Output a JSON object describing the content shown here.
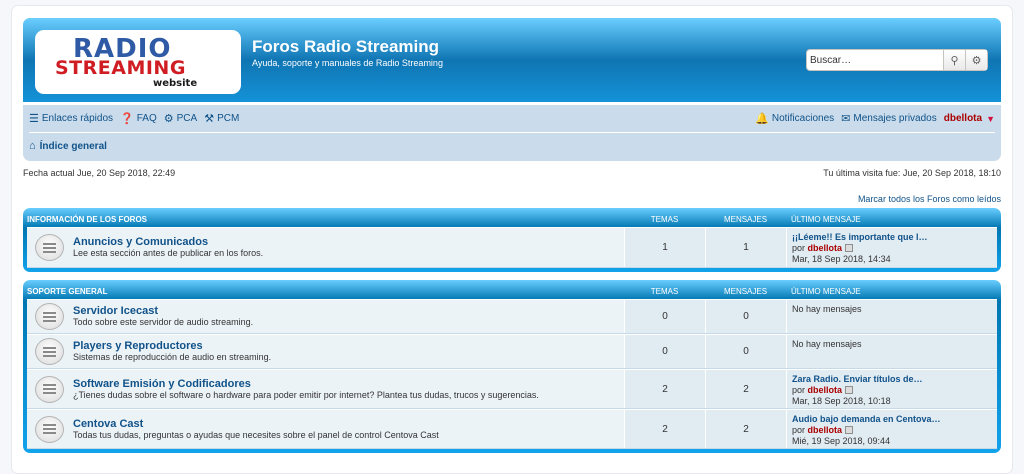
{
  "header": {
    "logo": {
      "line1": "RADIO",
      "line2": "STREAMING",
      "line3": "website"
    },
    "title": "Foros Radio Streaming",
    "description": "Ayuda, soporte y manuales de Radio Streaming",
    "search_placeholder": "Buscar…"
  },
  "nav": {
    "quick_links": "Enlaces rápidos",
    "faq": "FAQ",
    "pca": "PCA",
    "pcm": "PCM",
    "notifications": "Notificaciones",
    "private_messages": "Mensajes privados",
    "username": "dbellota",
    "breadcrumb": "Índice general"
  },
  "info": {
    "current_date": "Fecha actual Jue, 20 Sep 2018, 22:49",
    "last_visit": "Tu última visita fue: Jue, 20 Sep 2018, 18:10",
    "mark_read": "Marcar todos los Foros como leídos"
  },
  "categories": [
    {
      "title": "INFORMACIÓN DE LOS FOROS",
      "col_topics": "TEMAS",
      "col_posts": "MENSAJES",
      "col_last": "ÚLTIMO MENSAJE",
      "forums": [
        {
          "name": "Anuncios y Comunicados",
          "desc": "Lee esta sección antes de publicar en los foros.",
          "topics": "1",
          "posts": "1",
          "last_title": "¡¡Léeme!! Es importante que l…",
          "last_by": "por",
          "last_user": "dbellota",
          "last_date": "Mar, 18 Sep 2018, 14:34"
        }
      ]
    },
    {
      "title": "SOPORTE GENERAL",
      "col_topics": "TEMAS",
      "col_posts": "MENSAJES",
      "col_last": "ÚLTIMO MENSAJE",
      "forums": [
        {
          "name": "Servidor Icecast",
          "desc": "Todo sobre este servidor de audio streaming.",
          "topics": "0",
          "posts": "0",
          "no_posts": "No hay mensajes"
        },
        {
          "name": "Players y Reproductores",
          "desc": "Sistemas de reproducción de audio en streaming.",
          "topics": "0",
          "posts": "0",
          "no_posts": "No hay mensajes"
        },
        {
          "name": "Software Emisión y Codificadores",
          "desc": "¿Tienes dudas sobre el software o hardware para poder emitir por internet? Plantea tus dudas, trucos y sugerencias.",
          "topics": "2",
          "posts": "2",
          "last_title": "Zara Radio. Enviar títulos de…",
          "last_by": "por",
          "last_user": "dbellota",
          "last_date": "Mar, 18 Sep 2018, 10:18"
        },
        {
          "name": "Centova Cast",
          "desc": "Todas tus dudas, preguntas o ayudas que necesites sobre el panel de control Centova Cast",
          "topics": "2",
          "posts": "2",
          "last_title": "Audio bajo demanda en Centova…",
          "last_by": "por",
          "last_user": "dbellota",
          "last_date": "Mié, 19 Sep 2018, 09:44"
        }
      ]
    }
  ]
}
